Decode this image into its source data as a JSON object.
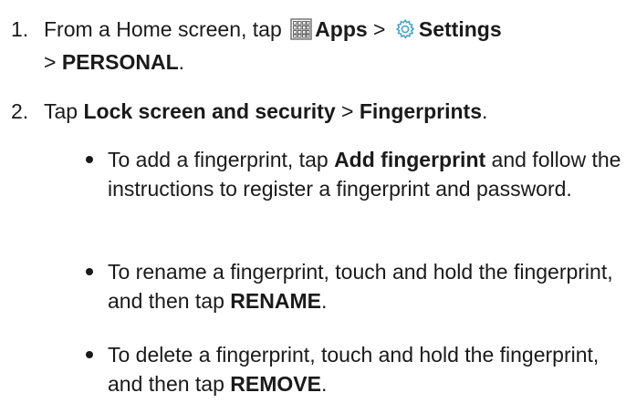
{
  "steps": [
    {
      "number": "1.",
      "t1": "From a Home screen, tap",
      "apps_label": "Apps",
      "sep1": ">",
      "settings_label": "Settings",
      "sep2": ">",
      "personal_label": "PERSONAL",
      "end": ".",
      "icons": [
        "apps-grid-icon",
        "settings-gear-icon"
      ]
    },
    {
      "number": "2.",
      "t1": "Tap",
      "lock_label": "Lock screen and security",
      "sep": ">",
      "fingerprints_label": "Fingerprints",
      "end": "."
    }
  ],
  "bullets": [
    {
      "t1": "To add a fingerprint, tap",
      "bold": "Add fingerprint",
      "t2": "and follow the instructions to register a fingerprint and password."
    },
    {
      "t1": "To rename a fingerprint, touch and hold the fingerprint, and then tap",
      "bold": "RENAME",
      "t2": "."
    },
    {
      "t1": "To delete a fingerprint, touch and hold the fingerprint, and then tap",
      "bold": "REMOVE",
      "t2": "."
    }
  ],
  "colors": {
    "text": "#1a1a1a",
    "apps_icon": "#6b6b6b",
    "settings_icon": "#4aa3c8"
  }
}
